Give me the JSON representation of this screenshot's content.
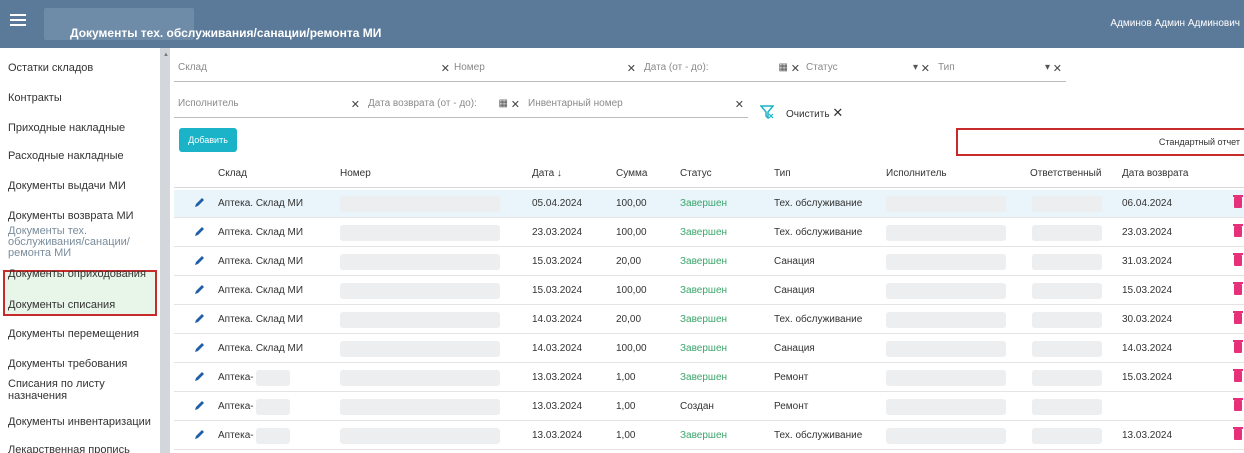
{
  "header": {
    "title": "Документы тех. обслуживания/санации/ремонта МИ",
    "user": "Админов Админ Админович"
  },
  "sidebar": {
    "items": [
      {
        "label": "Остатки складов"
      },
      {
        "label": "Контракты"
      },
      {
        "label": "Приходные накладные"
      },
      {
        "label": "Расходные накладные"
      },
      {
        "label": "Документы выдачи МИ"
      },
      {
        "label": "Документы возврата МИ"
      },
      {
        "label": "Документы тех. обслуживания/санации/ ремонта МИ"
      },
      {
        "label": "Документы оприходования"
      },
      {
        "label": "Документы списания"
      },
      {
        "label": "Документы перемещения"
      },
      {
        "label": "Документы требования"
      },
      {
        "label": "Списания по листу назначения"
      },
      {
        "label": "Документы инвентаризации"
      },
      {
        "label": "Лекарственная пропись"
      }
    ]
  },
  "filters": {
    "warehouse": "Склад",
    "number": "Номер",
    "date_range": "Дата (от - до):",
    "status": "Статус",
    "type": "Тип",
    "executor": "Исполнитель",
    "return_date": "Дата возврата (от - до):",
    "inventory_number": "Инвентарный номер",
    "clear_label": "Очистить",
    "clear_symbol": "✕"
  },
  "actions": {
    "add_label": "Добавить",
    "std_report_label": "Стандартный отчет"
  },
  "table": {
    "columns": {
      "warehouse": "Склад",
      "number": "Номер",
      "date": "Дата ↓",
      "sum": "Сумма",
      "status": "Статус",
      "type": "Тип",
      "executor": "Исполнитель",
      "responsible": "Ответственный",
      "return_date": "Дата возврата"
    },
    "rows": [
      {
        "warehouse": "Аптека. Склад МИ",
        "date": "05.04.2024",
        "sum": "100,00",
        "status": "Завершен",
        "type": "Тех. обслуживание",
        "return_date": "06.04.2024"
      },
      {
        "warehouse": "Аптека. Склад МИ",
        "date": "23.03.2024",
        "sum": "100,00",
        "status": "Завершен",
        "type": "Тех. обслуживание",
        "return_date": "23.03.2024"
      },
      {
        "warehouse": "Аптека. Склад МИ",
        "date": "15.03.2024",
        "sum": "20,00",
        "status": "Завершен",
        "type": "Санация",
        "return_date": "31.03.2024"
      },
      {
        "warehouse": "Аптека. Склад МИ",
        "date": "15.03.2024",
        "sum": "100,00",
        "status": "Завершен",
        "type": "Санация",
        "return_date": "15.03.2024"
      },
      {
        "warehouse": "Аптека. Склад МИ",
        "date": "14.03.2024",
        "sum": "20,00",
        "status": "Завершен",
        "type": "Тех. обслуживание",
        "return_date": "30.03.2024"
      },
      {
        "warehouse": "Аптека. Склад МИ",
        "date": "14.03.2024",
        "sum": "100,00",
        "status": "Завершен",
        "type": "Санация",
        "return_date": "14.03.2024"
      },
      {
        "warehouse": "Аптека-",
        "date": "13.03.2024",
        "sum": "1,00",
        "status": "Завершен",
        "type": "Ремонт",
        "return_date": "15.03.2024"
      },
      {
        "warehouse": "Аптека-",
        "date": "13.03.2024",
        "sum": "1,00",
        "status": "Создан",
        "type": "Ремонт",
        "return_date": ""
      },
      {
        "warehouse": "Аптека-",
        "date": "13.03.2024",
        "sum": "1,00",
        "status": "Завершен",
        "type": "Тех. обслуживание",
        "return_date": "13.03.2024"
      }
    ]
  },
  "colors": {
    "header_bg": "#5b7a99",
    "accent": "#1ab3c8",
    "status_done": "#3aa56a",
    "delete": "#e6317a",
    "highlight_border": "#c72a2a"
  }
}
